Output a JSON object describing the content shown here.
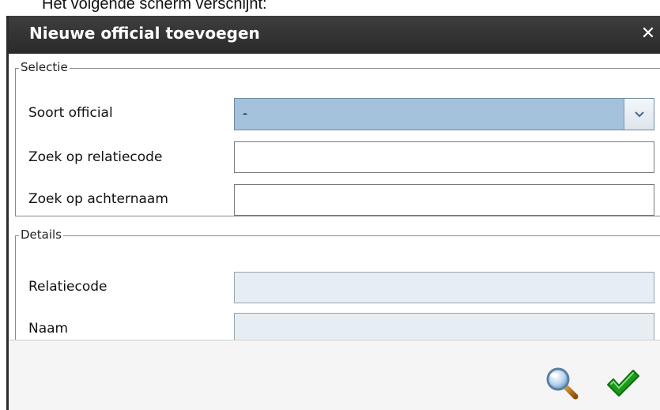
{
  "doc_text": "Het volgende scherm verschijnt:",
  "dialog": {
    "title": "Nieuwe official toevoegen",
    "close_symbol": "✕"
  },
  "selectie": {
    "legend": "Selectie",
    "soort_label": "Soort official",
    "soort_value": "-",
    "relatiecode_label": "Zoek op relatiecode",
    "relatiecode_value": "",
    "achternaam_label": "Zoek op achternaam",
    "achternaam_value": ""
  },
  "details": {
    "legend": "Details",
    "relatiecode_label": "Relatiecode",
    "relatiecode_value": "",
    "naam_label": "Naam",
    "naam_value": ""
  },
  "footer": {
    "search_icon": "magnifier-icon",
    "confirm_icon": "checkmark-icon",
    "confirm_color": "#1a9a1a"
  }
}
